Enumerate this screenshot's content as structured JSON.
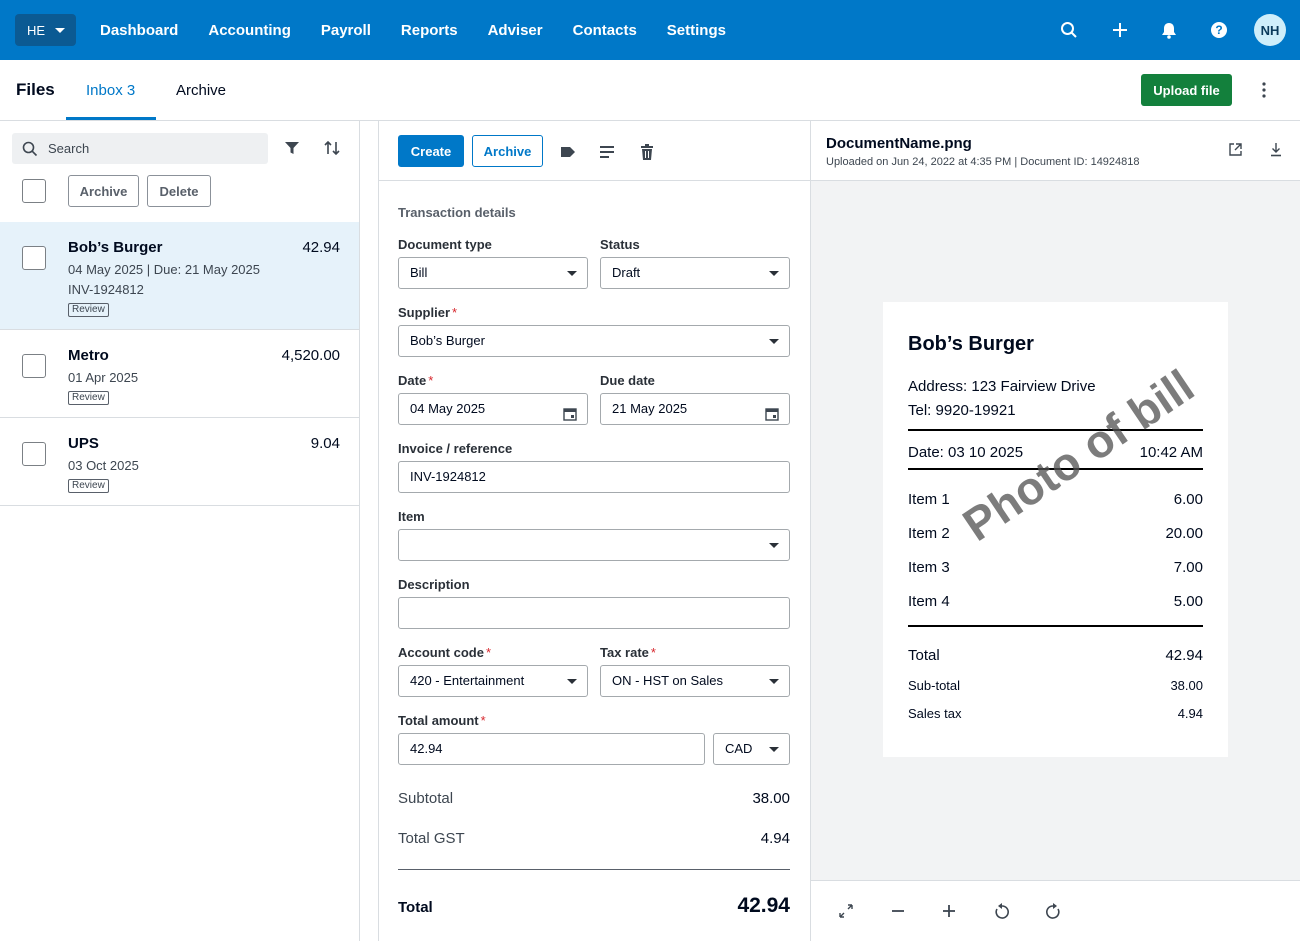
{
  "topnav": {
    "org": "HE",
    "links": [
      "Dashboard",
      "Accounting",
      "Payroll",
      "Reports",
      "Adviser",
      "Contacts",
      "Settings"
    ],
    "avatar": "NH",
    "icons": [
      "search-icon",
      "plus-icon",
      "bell-icon",
      "help-icon"
    ]
  },
  "subhead": {
    "title": "Files",
    "tab_inbox": "Inbox 3",
    "tab_archive": "Archive",
    "upload": "Upload file"
  },
  "left": {
    "search_placeholder": "Search",
    "archive_btn": "Archive",
    "delete_btn": "Delete",
    "items": [
      {
        "name": "Bob’s Burger",
        "amount": "42.94",
        "line1": "04 May 2025 | Due: 21 May 2025",
        "line2": "INV-1924812",
        "badge": "Review"
      },
      {
        "name": "Metro",
        "amount": "4,520.00",
        "line1": "01 Apr 2025",
        "badge": "Review"
      },
      {
        "name": "UPS",
        "amount": "9.04",
        "line1": "03 Oct 2025",
        "badge": "Review"
      }
    ]
  },
  "form": {
    "create": "Create",
    "archive": "Archive",
    "section": "Transaction details",
    "doc_type_label": "Document type",
    "doc_type": "Bill",
    "status_label": "Status",
    "status": "Draft",
    "supplier_label": "Supplier",
    "supplier": "Bob’s Burger",
    "date_label": "Date",
    "date": "04 May 2025",
    "due_label": "Due date",
    "due": "21 May 2025",
    "invoice_label": "Invoice / reference",
    "invoice": "INV-1924812",
    "item_label": "Item",
    "item": "",
    "desc_label": "Description",
    "desc": "",
    "account_label": "Account code",
    "account": "420 - Entertainment",
    "tax_label": "Tax rate",
    "tax": "ON - HST on Sales",
    "amount_label": "Total amount",
    "amount": "42.94",
    "currency": "CAD",
    "required_mark": "*",
    "subtotal_label": "Subtotal",
    "subtotal": "38.00",
    "gst_label": "Total GST",
    "gst": "4.94",
    "total_label": "Total",
    "total": "42.94"
  },
  "document": {
    "name": "DocumentName.png",
    "meta": "Uploaded on Jun 24, 2022 at 4:35 PM | Document ID: 14924818",
    "receipt": {
      "title": "Bob’s Burger",
      "address": "Address: 123 Fairview Drive",
      "tel": "Tel: 9920-19921",
      "date": "Date: 03 10 2025",
      "time": "10:42 AM",
      "items": [
        {
          "label": "Item 1",
          "value": "6.00"
        },
        {
          "label": "Item 2",
          "value": "20.00"
        },
        {
          "label": "Item 3",
          "value": "7.00"
        },
        {
          "label": "Item 4",
          "value": "5.00"
        }
      ],
      "total_label": "Total",
      "total": "42.94",
      "subtotal_label": "Sub-total",
      "subtotal": "38.00",
      "tax_label": "Sales tax",
      "tax": "4.94",
      "watermark": "Photo of bill"
    }
  },
  "colors": {
    "brand_blue": "#0078c8",
    "upload_green": "#13803c",
    "selected_row": "#e6f2fa"
  }
}
